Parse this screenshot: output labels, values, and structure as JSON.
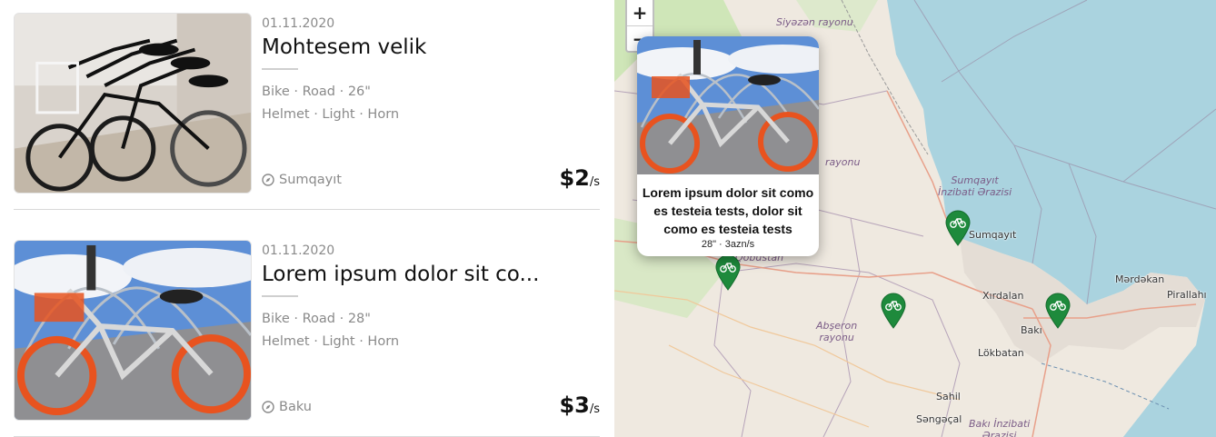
{
  "listings": [
    {
      "date": "01.11.2020",
      "title": "Mohtesem velik",
      "specs_line1": "Bike · Road · 26\"",
      "specs_line2": "Helmet · Light · Horn",
      "location": "Sumqayıt",
      "price": "$2",
      "price_unit": "/s"
    },
    {
      "date": "01.11.2020",
      "title": "Lorem ipsum dolor sit co...",
      "specs_line1": "Bike · Road · 28\"",
      "specs_line2": "Helmet · Light · Horn",
      "location": "Baku",
      "price": "$3",
      "price_unit": "/s"
    }
  ],
  "map": {
    "zoom_in": "+",
    "zoom_out": "−",
    "popup": {
      "title": "Lorem ipsum dolor sit como es testeia tests, dolor sit como es testeia tests",
      "subtitle": "28\" · 3azn/s"
    },
    "labels": {
      "siyazan": "Siyəzən rayonu",
      "rayonu_mid": "rayonu",
      "sumqayit_area_1": "Sumqayıt",
      "sumqayit_area_2": "İnzibati Ərazisi",
      "qobustan": "Qobustan",
      "abseron_1": "Abşeron",
      "abseron_2": "rayonu",
      "baki_area_1": "Bakı İnzibati",
      "baki_area_2": "Ərazisi"
    },
    "cities": {
      "sumqayit": "Sumqayıt",
      "xirdalan": "Xırdalan",
      "baki": "Bakı",
      "mardakan": "Mərdəkan",
      "pirallahi": "Pirallahı",
      "lokbatan": "Lökbatan",
      "sahil": "Sahil",
      "sangachal": "Səngəçal"
    },
    "marker_color": "#1e8a3c",
    "water_color": "#aad3df",
    "land_color": "#efe9e0"
  }
}
